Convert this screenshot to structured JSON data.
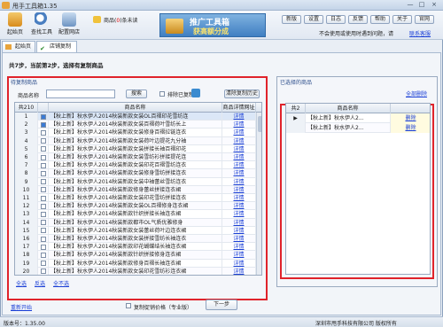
{
  "app": {
    "title": "甩手工具箱1.35"
  },
  "titlebar": {
    "minimize": "—",
    "maximize": "□",
    "close": "×"
  },
  "toolbar": {
    "home": "起始页",
    "search": "查找工具",
    "config": "配置网店",
    "shop_prefix": "商品",
    "shop_count": "0",
    "shop_suffix": "条未读"
  },
  "banner": {
    "main": "推广工具箱",
    "sub": "获高额分成"
  },
  "header_buttons": [
    "新版",
    "设置",
    "日志",
    "反馈",
    "帮助",
    "关于",
    "官网"
  ],
  "header_note": "不会使用或使用时遇到问题，请",
  "header_link": "联系客服",
  "tabs": [
    "起始页",
    "店铺复制"
  ],
  "step": {
    "text": "共7步，当前第2步，选择有复制商品"
  },
  "left": {
    "legend": "待复制商品",
    "name_label": "商品名称",
    "name_value": "",
    "search_btn": "搜索",
    "exclude_label": "排除已复制",
    "clear_btn": "清除复制历史",
    "total": "共210",
    "col_name": "商品名称",
    "col_url": "商品详情网址",
    "rows": [
      {
        "n": "1",
        "checked": true,
        "name": "【秋上新】秋水伊人2014秋装新款女装OL百褶印花雪纺连",
        "link": "详情"
      },
      {
        "n": "2",
        "checked": true,
        "name": "【秋上新】秋水伊人2014秋装新款女装百褶荷叶雪纺长上",
        "link": "详情"
      },
      {
        "n": "3",
        "checked": false,
        "name": "【秋上新】秋水伊人2014秋装新款女装修身百褶拉链连衣",
        "link": "详情"
      },
      {
        "n": "4",
        "checked": false,
        "name": "【秋上新】秋水伊人2014秋装新款女装荷叶边提花九分袖",
        "link": "详情"
      },
      {
        "n": "5",
        "checked": false,
        "name": "【秋上新】秋水伊人2014秋装新款女装拼接长袖百褶印花",
        "link": "详情"
      },
      {
        "n": "6",
        "checked": false,
        "name": "【秋上新】秋水伊人2014秋装新款女装雪纺衫拼接提花连",
        "link": "详情"
      },
      {
        "n": "7",
        "checked": false,
        "name": "【秋上新】秋水伊人2014秋装新款女装印花百褶雪纺连衣",
        "link": "详情"
      },
      {
        "n": "8",
        "checked": false,
        "name": "【秋上新】秋水伊人2014秋装新款女装修身雪纺拼接连衣",
        "link": "详情"
      },
      {
        "n": "9",
        "checked": false,
        "name": "【秋上新】秋水伊人2014秋装新款女装中袖蕾丝雪纺连衣",
        "link": "详情"
      },
      {
        "n": "10",
        "checked": false,
        "name": "【秋上新】秋水伊人2014秋装新款修身蕾丝拼接连衣裙",
        "link": "详情"
      },
      {
        "n": "11",
        "checked": false,
        "name": "【秋上新】秋水伊人2014秋装新款女装印花雪纺拼接连衣",
        "link": "详情"
      },
      {
        "n": "12",
        "checked": false,
        "name": "【秋上新】秋水伊人2014秋装新款女装OL百褶修身连衣裙",
        "link": "详情"
      },
      {
        "n": "13",
        "checked": false,
        "name": "【秋上新】秋水伊人2014秋装新款针织拼接长袖连衣裙",
        "link": "详情"
      },
      {
        "n": "14",
        "checked": false,
        "name": "【秋上新】秋水伊人2014秋装新款都市OL气质优雅修身",
        "link": "详情"
      },
      {
        "n": "15",
        "checked": false,
        "name": "【秋上新】秋水伊人2014秋装新款女装蕾丝荷叶边连衣裙",
        "link": "详情"
      },
      {
        "n": "16",
        "checked": false,
        "name": "【秋上新】秋水伊人2014秋装新款女装拼接雪纺长袖连衣",
        "link": "详情"
      },
      {
        "n": "17",
        "checked": false,
        "name": "【秋上新】秋水伊人2014秋装新款印花蝴蝶结长袖连衣裙",
        "link": "详情"
      },
      {
        "n": "18",
        "checked": false,
        "name": "【秋上新】秋水伊人2014秋装新款针织拼接修身连衣裙",
        "link": "详情"
      },
      {
        "n": "19",
        "checked": false,
        "name": "【秋上新】秋水伊人2014秋装新款修身百褶长袖连衣裙",
        "link": "详情"
      },
      {
        "n": "20",
        "checked": false,
        "name": "【秋上新】秋水伊人2014秋装新款女装印花雪纺衫连衣裙",
        "link": "详情"
      }
    ],
    "select_all": "全选",
    "invert": "反选",
    "select_none": "全不选"
  },
  "right": {
    "legend": "已选择的商品",
    "delete_all": "全部删除",
    "total": "共2",
    "col_name": "商品名称",
    "rows": [
      {
        "name": "【秋上新】秋水伊人2...",
        "action": "删除"
      },
      {
        "name": "【秋上新】秋水伊人2...",
        "action": "删除"
      }
    ]
  },
  "bottom": {
    "restart": "重新开始",
    "copy_price_label": "复制促销价格（专业版）",
    "next": "下一步"
  },
  "status": {
    "version": "版本号：1.35.00",
    "company": "深圳市甩手科技有限公司 版权所有"
  }
}
